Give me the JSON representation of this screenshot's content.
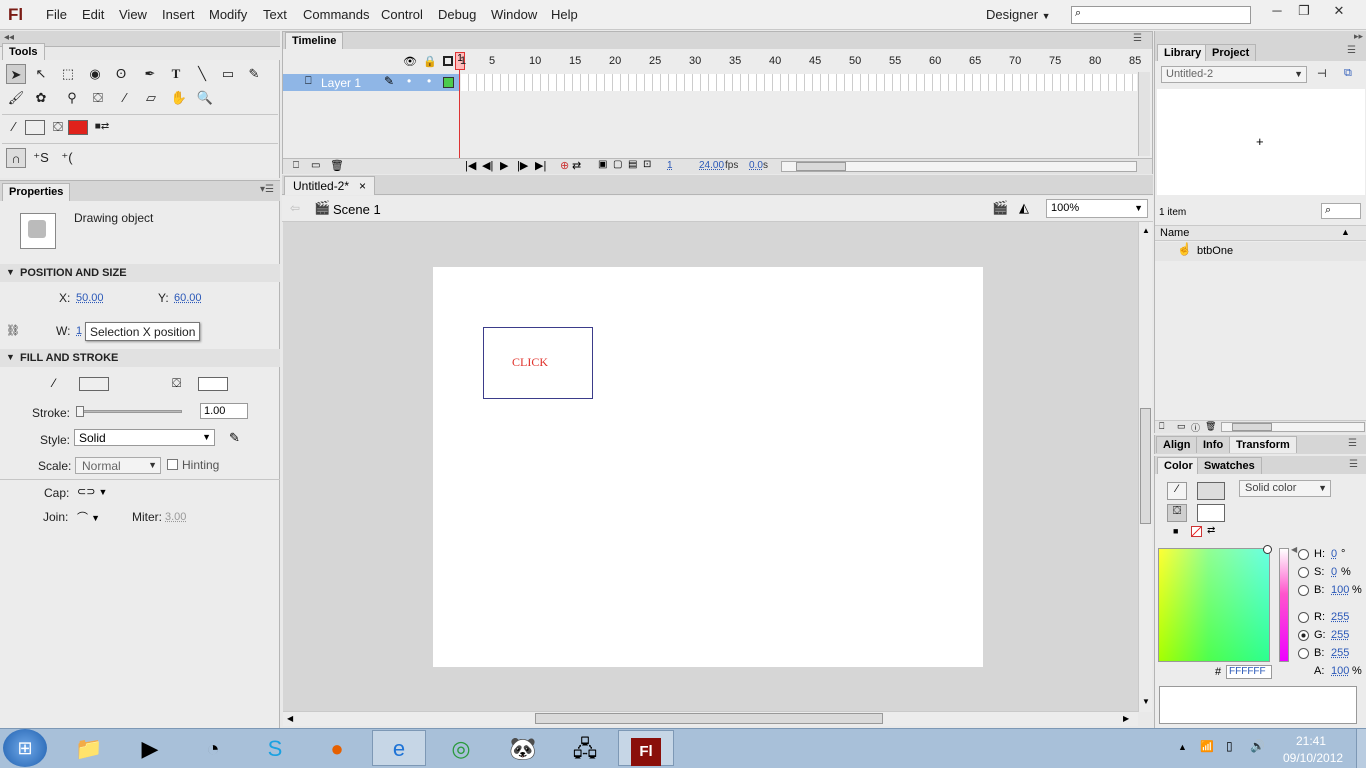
{
  "app": {
    "logo": "Fl"
  },
  "menu": [
    "File",
    "Edit",
    "View",
    "Insert",
    "Modify",
    "Text",
    "Commands",
    "Control",
    "Debug",
    "Window",
    "Help"
  ],
  "workspace": "Designer",
  "window_controls": {
    "minimize": "─",
    "restore": "❐",
    "close": "✕"
  },
  "tools_panel": {
    "title": "Tools"
  },
  "properties": {
    "tab": "Properties",
    "object_type": "Drawing object",
    "position_size": {
      "title": "POSITION AND SIZE",
      "x_label": "X:",
      "x_value": "50.00",
      "y_label": "Y:",
      "y_value": "60.00",
      "w_label": "W:",
      "w_value": "1",
      "tooltip": "Selection X position"
    },
    "fill_stroke": {
      "title": "FILL AND STROKE",
      "stroke_label": "Stroke:",
      "stroke_value": "1.00",
      "style_label": "Style:",
      "style_value": "Solid",
      "scale_label": "Scale:",
      "scale_value": "Normal",
      "hinting_label": "Hinting",
      "cap_label": "Cap:",
      "join_label": "Join:",
      "miter_label": "Miter:",
      "miter_value": "3.00"
    }
  },
  "timeline": {
    "tab": "Timeline",
    "layer_name": "Layer 1",
    "frame_numbers": [
      "1",
      "5",
      "10",
      "15",
      "20",
      "25",
      "30",
      "35",
      "40",
      "45",
      "50",
      "55",
      "60",
      "65",
      "70",
      "75",
      "80",
      "85"
    ],
    "current_frame": "1",
    "fps": "24.00",
    "fps_unit": "fps",
    "time": "0.0",
    "time_unit": "s"
  },
  "document": {
    "tab": "Untitled-2*",
    "close": "×",
    "scene": "Scene 1",
    "zoom": "100%"
  },
  "stage": {
    "button_text": "CLICK",
    "text_color": "#e0322b"
  },
  "library": {
    "tabs": [
      "Library",
      "Project"
    ],
    "document": "Untitled-2",
    "item_count": "1 item",
    "column_name": "Name",
    "items": [
      {
        "name": "btbOne"
      }
    ]
  },
  "transform_tabs": [
    "Align",
    "Info",
    "Transform"
  ],
  "color_panel": {
    "tabs": [
      "Color",
      "Swatches"
    ],
    "fill_type": "Solid color",
    "h_label": "H:",
    "h_value": "0",
    "h_unit": "°",
    "s_label": "S:",
    "s_value": "0",
    "s_unit": "%",
    "b_label": "B:",
    "b_value": "100",
    "b_unit": "%",
    "r_label": "R:",
    "r_value": "255",
    "g_label": "G:",
    "g_value": "255",
    "b2_label": "B:",
    "b2_value": "255",
    "hex_label": "#",
    "hex_value": "FFFFFF",
    "a_label": "A:",
    "a_value": "100",
    "a_unit": "%"
  },
  "taskbar": {
    "icons": [
      "windows-start-icon",
      "folder-icon",
      "media-player-icon",
      "clock-icon",
      "skype-icon",
      "firefox-icon",
      "internet-explorer-icon",
      "chrome-icon",
      "panda-icon",
      "network-icon",
      "flash-icon"
    ],
    "time": "21:41",
    "date": "09/10/2012"
  }
}
